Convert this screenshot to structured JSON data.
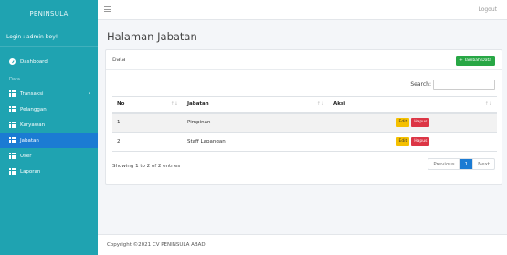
{
  "sidebar": {
    "brand": "PENINSULA",
    "login": "Login : admin boy!",
    "dashboard": "Dashboard",
    "section": "Data",
    "items": [
      {
        "label": "Transaksi",
        "active": false,
        "has_children": true
      },
      {
        "label": "Pelanggan",
        "active": false
      },
      {
        "label": "Karyawan",
        "active": false
      },
      {
        "label": "Jabatan",
        "active": true
      },
      {
        "label": "User",
        "active": false
      },
      {
        "label": "Laporan",
        "active": false
      }
    ]
  },
  "topbar": {
    "logout": "Logout"
  },
  "page": {
    "title": "Halaman Jabatan"
  },
  "card": {
    "title": "Data",
    "add_button": "+ Tambah Data",
    "search_label": "Search:",
    "search_value": "",
    "columns": [
      "No",
      "Jabatan",
      "Aksi"
    ],
    "rows": [
      {
        "no": "1",
        "jabatan": "Pimpinan",
        "edit": "Edit",
        "delete": "Hapus"
      },
      {
        "no": "2",
        "jabatan": "Staff Lapangan",
        "edit": "Edit",
        "delete": "Hapus"
      }
    ],
    "info": "Showing 1 to 2 of 2 entries",
    "pagination": {
      "previous": "Previous",
      "current": "1",
      "next": "Next"
    }
  },
  "footer": {
    "text": "Copyright ©2021 CV PENINSULA ABADI"
  },
  "colors": {
    "sidebar": "#1fa3b1",
    "active": "#1b7bd3",
    "add": "#28a745",
    "edit": "#f5c000",
    "delete": "#dc3545"
  }
}
